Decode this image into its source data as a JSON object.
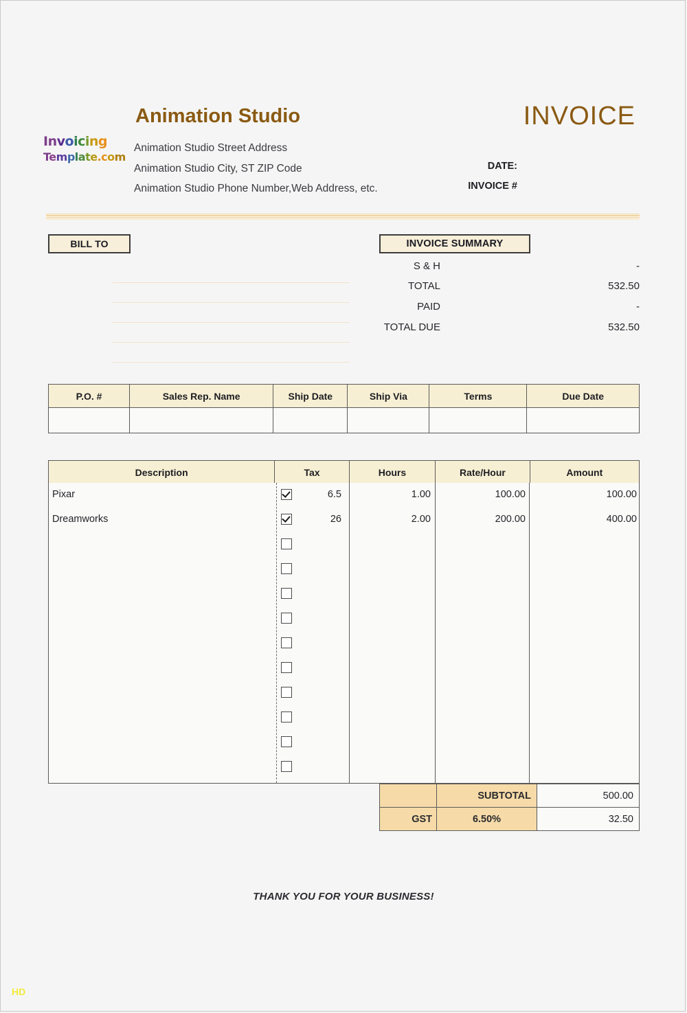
{
  "brand": {
    "logo_line1": "Invoicing",
    "logo_line2": "Template.com",
    "logo_colors_line1": [
      "#7d3f8c",
      "#7d3f8c",
      "#5b2d8e",
      "#3d5aa9",
      "#2f7d4f",
      "#3f8a3a",
      "#7a9a2a",
      "#c79a12",
      "#e8901a"
    ],
    "logo_colors_line2": [
      "#7d3f8c",
      "#8a3f8c",
      "#5b3d9e",
      "#3d6aa9",
      "#2f7d4f",
      "#4f8a3a",
      "#7a9a2a",
      "#b79a12",
      "#d8901a",
      "#e8901a",
      "#c79a12",
      "#b08010",
      "#9a6a10"
    ],
    "accent_color": "#8a5a12",
    "header_fill": "#f7efd3",
    "totals_fill": "#f6dba8"
  },
  "company": {
    "name": "Animation Studio",
    "address_lines": [
      "Animation Studio Street Address",
      "Animation Studio City, ST ZIP Code",
      "Animation Studio Phone Number,Web Address, etc."
    ]
  },
  "header": {
    "title": "INVOICE",
    "date_label": "DATE:",
    "date_value": "",
    "invoice_no_label": "INVOICE #",
    "invoice_no_value": ""
  },
  "bill_to": {
    "label": "BILL TO",
    "line_count": 5,
    "lines": [
      "",
      "",
      "",
      "",
      ""
    ]
  },
  "summary": {
    "label": "INVOICE SUMMARY",
    "rows": [
      {
        "key": "S & H",
        "value": "-"
      },
      {
        "key": "TOTAL",
        "value": "532.50"
      },
      {
        "key": "PAID",
        "value": "-"
      },
      {
        "key": "TOTAL DUE",
        "value": "532.50"
      }
    ]
  },
  "info_table": {
    "headers": [
      "P.O. #",
      "Sales Rep. Name",
      "Ship Date",
      "Ship Via",
      "Terms",
      "Due Date"
    ],
    "row": [
      "",
      "",
      "",
      "",
      "",
      ""
    ]
  },
  "items_table": {
    "headers": [
      "Description",
      "Tax",
      "Hours",
      "Rate/Hour",
      "Amount"
    ],
    "rows": [
      {
        "description": "Pixar",
        "taxed": true,
        "tax": "6.5",
        "hours": "1.00",
        "rate": "100.00",
        "amount": "100.00"
      },
      {
        "description": "Dreamworks",
        "taxed": true,
        "tax": "26",
        "hours": "2.00",
        "rate": "200.00",
        "amount": "400.00"
      },
      {
        "description": "",
        "taxed": false,
        "tax": "",
        "hours": "",
        "rate": "",
        "amount": ""
      },
      {
        "description": "",
        "taxed": false,
        "tax": "",
        "hours": "",
        "rate": "",
        "amount": ""
      },
      {
        "description": "",
        "taxed": false,
        "tax": "",
        "hours": "",
        "rate": "",
        "amount": ""
      },
      {
        "description": "",
        "taxed": false,
        "tax": "",
        "hours": "",
        "rate": "",
        "amount": ""
      },
      {
        "description": "",
        "taxed": false,
        "tax": "",
        "hours": "",
        "rate": "",
        "amount": ""
      },
      {
        "description": "",
        "taxed": false,
        "tax": "",
        "hours": "",
        "rate": "",
        "amount": ""
      },
      {
        "description": "",
        "taxed": false,
        "tax": "",
        "hours": "",
        "rate": "",
        "amount": ""
      },
      {
        "description": "",
        "taxed": false,
        "tax": "",
        "hours": "",
        "rate": "",
        "amount": ""
      },
      {
        "description": "",
        "taxed": false,
        "tax": "",
        "hours": "",
        "rate": "",
        "amount": ""
      },
      {
        "description": "",
        "taxed": false,
        "tax": "",
        "hours": "",
        "rate": "",
        "amount": ""
      }
    ]
  },
  "totals": {
    "subtotal_label": "SUBTOTAL",
    "subtotal_value": "500.00",
    "tax_name": "GST",
    "tax_rate": "6.50%",
    "tax_value": "32.50"
  },
  "footer": {
    "thanks": "THANK YOU FOR YOUR BUSINESS!",
    "watermark": "HD"
  }
}
